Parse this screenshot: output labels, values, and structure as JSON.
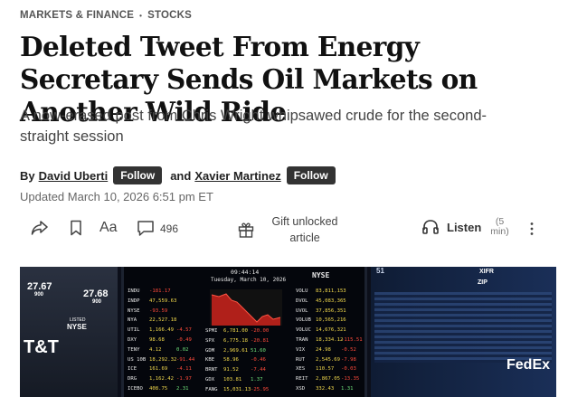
{
  "kicker": {
    "section": "MARKETS & FINANCE",
    "separator": "•",
    "subsection": "STOCKS"
  },
  "headline": "Deleted Tweet From Energy Secretary Sends Oil Markets on Another Wild Ride",
  "dek": "A now-erased post from Chris Wright whipsawed crude for the second-straight session",
  "byline": {
    "prefix": "By",
    "authors": [
      {
        "name": "David Uberti",
        "follow_label": "Follow"
      },
      {
        "name": "Xavier Martinez",
        "follow_label": "Follow"
      }
    ],
    "conjunction": "and"
  },
  "updated": "Updated March 10, 2026 6:51 pm ET",
  "toolbar": {
    "share_icon": "share-icon",
    "save_icon": "bookmark-icon",
    "text_size_label": "Aa",
    "comments_icon": "comment-icon",
    "comments_count": "496",
    "gift_icon": "gift-icon",
    "gift_label_line1": "Gift unlocked",
    "gift_label_line2": "article",
    "listen_icon": "headphones-icon",
    "listen_label": "Listen",
    "listen_duration_line1": "(5",
    "listen_duration_line2": "min)",
    "more_icon": "more-vertical-icon"
  },
  "photo": {
    "left_screen": {
      "top_num1": "27.67",
      "top_num2": "27.68",
      "sub1": "900",
      "sub2": "900",
      "label_listed": "LISTED",
      "label_nyse": "NYSE",
      "brand": "T&T"
    },
    "center_screen": {
      "time": "09:44:14",
      "date": "Tuesday, March 10, 2026",
      "logo": "NYSE",
      "rows_left": [
        [
          "INDU",
          "-181.17",
          ""
        ],
        [
          "INDP",
          "47,559.63",
          ""
        ],
        [
          "NYSE",
          "-93.59",
          ""
        ],
        [
          "NYA",
          "22,527.18",
          ""
        ],
        [
          "UTIL",
          "1,166.49",
          "-4.57"
        ],
        [
          "DXY",
          "98.68",
          "-0.49"
        ],
        [
          "TENY",
          "4.12",
          "0.02"
        ],
        [
          "US 10B",
          "18,292.32",
          "-91.44"
        ],
        [
          "ICE",
          "161.69",
          "-4.11"
        ],
        [
          "DRG",
          "1,162.42",
          "-1.97"
        ],
        [
          "ICEBO",
          "408.75",
          "2.31"
        ]
      ],
      "rows_mid": [
        [
          "SPMI",
          "6,781.00",
          "-20.00"
        ],
        [
          "SPX",
          "6,775.18",
          "-20.81"
        ],
        [
          "GDM",
          "2,969.61",
          "51.60"
        ],
        [
          "KBE",
          "58.96",
          "-0.46"
        ],
        [
          "BRNT",
          "91.52",
          "-7.44"
        ],
        [
          "GDX",
          "103.81",
          "1.37"
        ],
        [
          "FANG",
          "15,031.13",
          "-25.95"
        ]
      ],
      "rows_right": [
        [
          "VOLU",
          "83,811,153",
          ""
        ],
        [
          "DVOL",
          "45,083,365",
          ""
        ],
        [
          "UVOL",
          "37,856,351",
          ""
        ],
        [
          "VOLUB",
          "10,565,216",
          ""
        ],
        [
          "VOLUC",
          "14,676,321",
          ""
        ],
        [
          "TRAN",
          "18,334.12",
          "-115.51"
        ],
        [
          "VIX",
          "24.98",
          "-0.52"
        ],
        [
          "RUT",
          "2,545.69",
          "-7.98"
        ],
        [
          "XES",
          "110.57",
          "-0.03"
        ],
        [
          "REIT",
          "2,867.05",
          "-13.35"
        ],
        [
          "XSD",
          "332.43",
          "1.31"
        ]
      ]
    },
    "right_screen": {
      "num1": "51",
      "label1": "XIFR",
      "label2": "ZIP",
      "brand": "FedEx"
    }
  },
  "colors": {
    "follow_bg": "#333333",
    "ticker_red": "#ff4a3a",
    "ticker_yellow": "#f2d94c"
  }
}
